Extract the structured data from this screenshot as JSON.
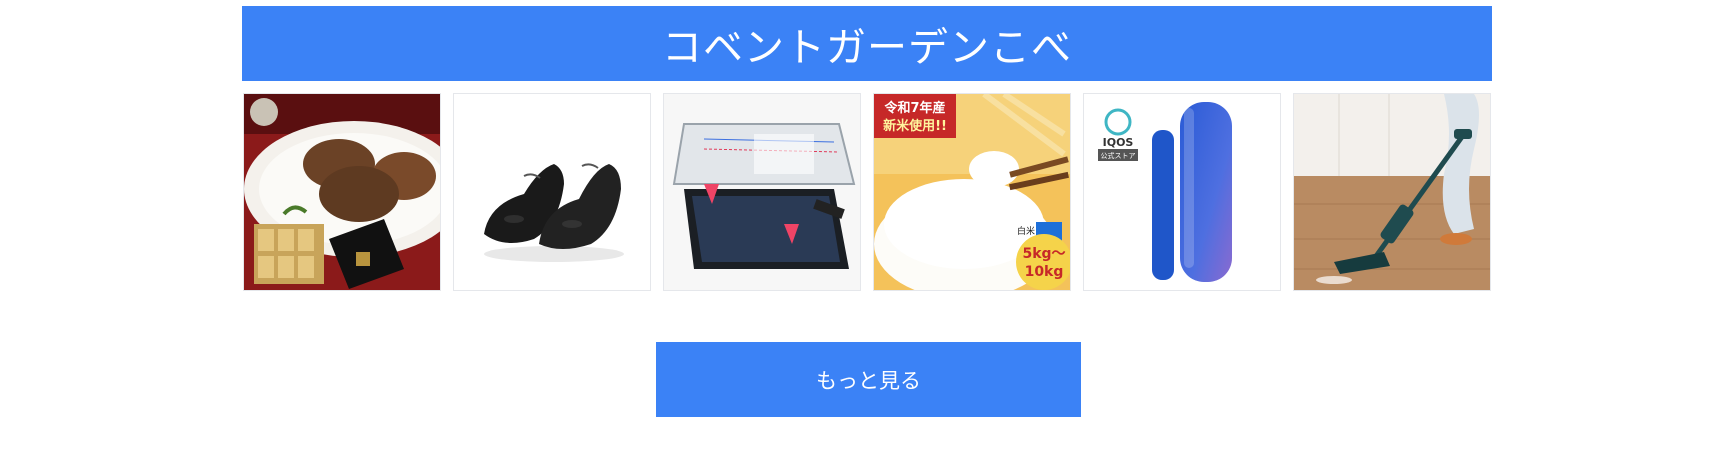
{
  "header": {
    "title": "コベントガーデンこべ"
  },
  "products": [
    {
      "image": "hamburg-steak-gift-set-image",
      "badge_lines": []
    },
    {
      "image": "black-leather-shoes-image",
      "badge_lines": []
    },
    {
      "image": "phone-screen-protector-image",
      "badge_lines": []
    },
    {
      "image": "white-rice-bowl-image",
      "badge_lines": [
        "令和7年産",
        "新米使用!!"
      ],
      "weight_line1": "5kg～",
      "weight_line2": "10kg",
      "tag": "白米"
    },
    {
      "image": "iqos-device-image",
      "brand": "IQOS",
      "sub_label": "公式ストア"
    },
    {
      "image": "cordless-wet-vacuum-image",
      "badge_lines": []
    }
  ],
  "more_button": {
    "label": "もっと見る"
  },
  "colors": {
    "accent": "#3b82f6",
    "text_on_accent": "#ffffff"
  }
}
